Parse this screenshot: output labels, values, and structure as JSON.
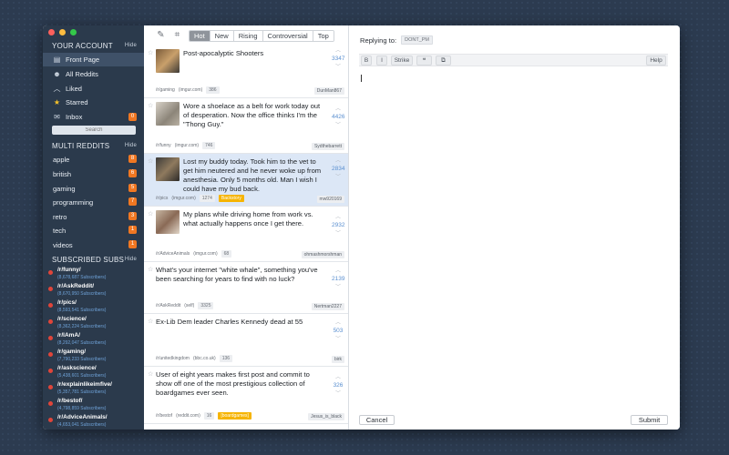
{
  "sidebar": {
    "account_header": "YOUR ACCOUNT",
    "hide_label": "Hide",
    "nav": [
      {
        "label": "Front Page",
        "icon": "page-icon"
      },
      {
        "label": "All Reddits",
        "icon": "alien-icon"
      },
      {
        "label": "Liked",
        "icon": "chevron-up-icon"
      },
      {
        "label": "Starred",
        "icon": "star-icon"
      },
      {
        "label": "Inbox",
        "icon": "inbox-icon",
        "badge": "0"
      }
    ],
    "search_placeholder": "Search",
    "multi_header": "MULTI REDDITS",
    "multi": [
      {
        "label": "apple",
        "badge": "8"
      },
      {
        "label": "british",
        "badge": "6"
      },
      {
        "label": "gaming",
        "badge": "5"
      },
      {
        "label": "programming",
        "badge": "7"
      },
      {
        "label": "retro",
        "badge": "3"
      },
      {
        "label": "tech",
        "badge": "1"
      },
      {
        "label": "videos",
        "badge": "1"
      }
    ],
    "subs_header": "SUBSCRIBED SUBS",
    "subs": [
      {
        "name": "/r/funny/",
        "count": "(8,678,687 Subscribers)"
      },
      {
        "name": "/r/AskReddit/",
        "count": "(8,670,950 Subscribers)"
      },
      {
        "name": "/r/pics/",
        "count": "(8,593,541 Subscribers)"
      },
      {
        "name": "/r/science/",
        "count": "(8,362,224 Subscribers)"
      },
      {
        "name": "/r/IAmA/",
        "count": "(8,292,047 Subscribers)"
      },
      {
        "name": "/r/gaming/",
        "count": "(7,790,233 Subscribers)"
      },
      {
        "name": "/r/askscience/",
        "count": "(5,438,601 Subscribers)"
      },
      {
        "name": "/r/explainlikeimfive/",
        "count": "(5,357,781 Subscribers)"
      },
      {
        "name": "/r/bestof/",
        "count": "(4,798,859 Subscribers)"
      },
      {
        "name": "/r/AdviceAnimals/",
        "count": "(4,653,041 Subscribers)"
      }
    ],
    "colors": {
      "badge": "#f07722",
      "sub_dot": "#e0453a",
      "bg": "#2b3a4c"
    }
  },
  "toolbar": {
    "compose_icon": "compose-icon",
    "refresh_icon": "crop-icon",
    "tabs": [
      "Hot",
      "New",
      "Rising",
      "Controversial",
      "Top"
    ],
    "active_tab": "Hot"
  },
  "posts": [
    {
      "title": "Post-apocalyptic Shooters",
      "score": "3347",
      "sub": "/r/gaming",
      "domain": "(imgur.com)",
      "comments": "386",
      "author": "DunMan867",
      "flair": "",
      "thumb": true
    },
    {
      "title": "Wore a shoelace as a belt for work today out of desperation. Now the office thinks I'm the \"Thong Guy.\"",
      "score": "4426",
      "sub": "/r/funny",
      "domain": "(imgur.com)",
      "comments": "746",
      "author": "Sydthebarrett",
      "flair": "",
      "thumb": true
    },
    {
      "title": "Lost my buddy today. Took him to the vet to get him neutered and he never woke up from anesthesia. Only 5 months old. Man I wish I could have my bud back.",
      "score": "2834",
      "sub": "/r/pics",
      "domain": "(imgur.com)",
      "comments": "1274",
      "author": "mw920169",
      "flair": "Backstory",
      "thumb": true,
      "selected": true
    },
    {
      "title": "My plans while driving home from work vs. what actually happens once I get there.",
      "score": "2932",
      "sub": "/r/AdviceAnimals",
      "domain": "(imgur.com)",
      "comments": "68",
      "author": "ohmashmorshman",
      "flair": "",
      "thumb": true
    },
    {
      "title": "What's your internet \"white whale\", something you've been searching for years to find with no luck?",
      "score": "2139",
      "sub": "/r/AskReddit",
      "domain": "(self)",
      "comments": "3325",
      "author": "Nertman2227",
      "flair": "",
      "thumb": false
    },
    {
      "title": "Ex-Lib Dem leader Charles Kennedy dead at 55",
      "score": "503",
      "sub": "/r/unitedkingdom",
      "domain": "(bbc.co.uk)",
      "comments": "136",
      "author": "birk",
      "flair": "",
      "thumb": false
    },
    {
      "title": "User of eight years makes first post and commit to show off one of the most prestigious collection of boardgames ever seen.",
      "score": "326",
      "sub": "/r/bestof",
      "domain": "(reddit.com)",
      "comments": "16",
      "author": "Jesus_is_black",
      "flair": "[boardgames]",
      "thumb": false
    }
  ],
  "reply": {
    "replying_label": "Replying to:",
    "replying_user": "DONT_PM",
    "format_buttons": [
      "B",
      "I",
      "Strike",
      "❝",
      "⧉"
    ],
    "help_label": "Help",
    "cancel_label": "Cancel",
    "submit_label": "Submit"
  }
}
